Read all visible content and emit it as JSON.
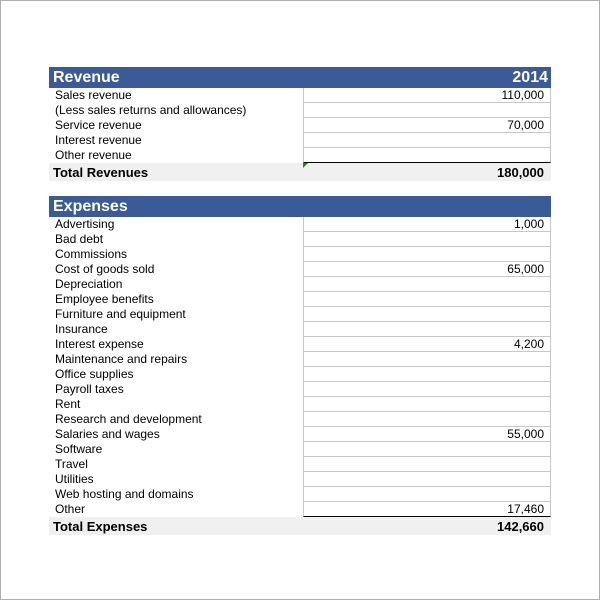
{
  "revenue": {
    "title": "Revenue",
    "year": "2014",
    "items": [
      {
        "label": "Sales revenue",
        "value": "110,000"
      },
      {
        "label": "(Less sales returns and allowances)",
        "value": ""
      },
      {
        "label": "Service revenue",
        "value": "70,000"
      },
      {
        "label": "Interest revenue",
        "value": ""
      },
      {
        "label": "Other revenue",
        "value": ""
      }
    ],
    "total_label": "Total Revenues",
    "total_value": "180,000"
  },
  "expenses": {
    "title": "Expenses",
    "items": [
      {
        "label": "Advertising",
        "value": "1,000"
      },
      {
        "label": "Bad debt",
        "value": ""
      },
      {
        "label": "Commissions",
        "value": ""
      },
      {
        "label": "Cost of goods sold",
        "value": "65,000"
      },
      {
        "label": "Depreciation",
        "value": ""
      },
      {
        "label": "Employee benefits",
        "value": ""
      },
      {
        "label": "Furniture and equipment",
        "value": ""
      },
      {
        "label": "Insurance",
        "value": ""
      },
      {
        "label": "Interest expense",
        "value": "4,200"
      },
      {
        "label": "Maintenance and repairs",
        "value": ""
      },
      {
        "label": "Office supplies",
        "value": ""
      },
      {
        "label": "Payroll taxes",
        "value": ""
      },
      {
        "label": "Rent",
        "value": ""
      },
      {
        "label": "Research and development",
        "value": ""
      },
      {
        "label": "Salaries and wages",
        "value": "55,000"
      },
      {
        "label": "Software",
        "value": ""
      },
      {
        "label": "Travel",
        "value": ""
      },
      {
        "label": "Utilities",
        "value": ""
      },
      {
        "label": "Web hosting and domains",
        "value": ""
      },
      {
        "label": "Other",
        "value": "17,460"
      }
    ],
    "total_label": "Total Expenses",
    "total_value": "142,660"
  }
}
